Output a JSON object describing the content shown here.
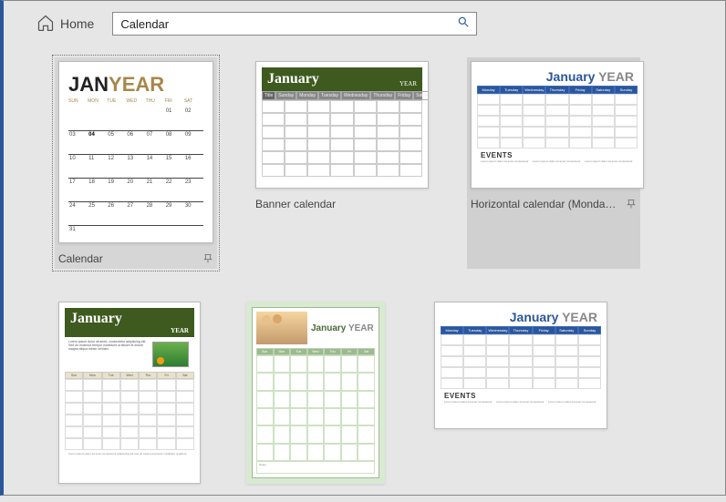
{
  "app": {
    "home_label": "Home",
    "search_value": "Calendar"
  },
  "templates": {
    "t1": {
      "caption": "Calendar",
      "month": "JAN",
      "year": "YEAR",
      "days": [
        "SUN",
        "MON",
        "TUE",
        "WED",
        "THU",
        "FRI",
        "SAT"
      ]
    },
    "t2": {
      "caption": "Banner calendar",
      "month": "January",
      "year": "YEAR",
      "title_label": "Title",
      "days": [
        "Sunday",
        "Monday",
        "Tuesday",
        "Wednesday",
        "Thursday",
        "Friday",
        "Saturday"
      ]
    },
    "t3": {
      "caption": "Horizontal calendar (Monday st...",
      "month": "January",
      "year": "YEAR",
      "events_label": "EVENTS",
      "days": [
        "Monday",
        "Tuesday",
        "Wednesday",
        "Thursday",
        "Friday",
        "Saturday",
        "Sunday"
      ]
    },
    "t4": {
      "month": "January",
      "year": "YEAR",
      "days": [
        "Sun",
        "Mon",
        "Tue",
        "Wed",
        "Thu",
        "Fri",
        "Sat"
      ]
    },
    "t5": {
      "month": "January",
      "year": "YEAR",
      "days": [
        "Sun",
        "Mon",
        "Tue",
        "Wed",
        "Thu",
        "Fri",
        "Sat"
      ],
      "notes": "Notes"
    },
    "t6": {
      "month": "January",
      "year": "YEAR",
      "events_label": "EVENTS",
      "days": [
        "Monday",
        "Tuesday",
        "Wednesday",
        "Thursday",
        "Friday",
        "Saturday",
        "Sunday"
      ]
    }
  }
}
